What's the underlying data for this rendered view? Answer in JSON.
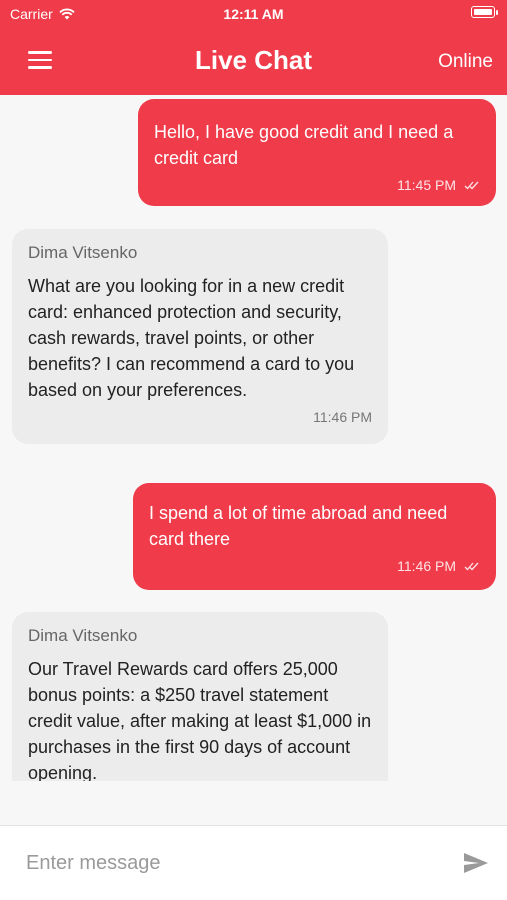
{
  "status_bar": {
    "carrier": "Carrier",
    "time": "12:11 AM"
  },
  "header": {
    "title": "Live Chat",
    "status": "Online"
  },
  "messages": [
    {
      "direction": "outgoing",
      "text": "Hello, I have good credit and I need a credit card",
      "time": "11:45 PM"
    },
    {
      "direction": "incoming",
      "sender": "Dima Vitsenko",
      "text": "What are you looking for in a new credit card: enhanced protection and security, cash rewards, travel points, or other benefits? I can recommend a card to you based on your preferences.",
      "time": "11:46 PM"
    },
    {
      "direction": "outgoing",
      "text": "I spend a lot of time abroad and need card there",
      "time": "11:46 PM"
    },
    {
      "direction": "incoming",
      "sender": "Dima Vitsenko",
      "text": "Our Travel Rewards card offers 25,000 bonus points: a $250 travel statement credit value, after making at least $1,000 in purchases in the first 90 days of account opening."
    }
  ],
  "composer": {
    "placeholder": "Enter message"
  },
  "colors": {
    "accent": "#ef3b4a",
    "incoming_bubble": "#ececec",
    "background": "#f7f7f7"
  }
}
